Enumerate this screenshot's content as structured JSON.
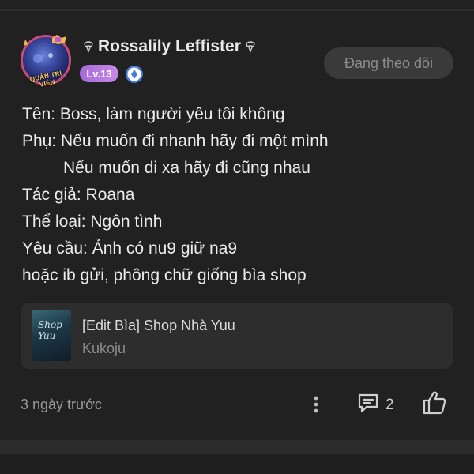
{
  "post": {
    "author": {
      "name": "Rossalily Leffister",
      "level": "Lv.13",
      "role_badge": "QUẢN TRỊ VIÊN"
    },
    "follow_button": "Đang theo dõi",
    "content_lines": [
      "Tên: Boss, làm người yêu tôi không",
      "Phụ: Nếu muốn đi nhanh hãy đi một mình",
      "Nếu muốn di xa hãy đi cũng nhau",
      "Tác giả: Roana",
      "Thể loại: Ngôn tình",
      "Yêu cầu: Ảnh có nu9 giữ na9",
      "hoặc ib gửi, phông chữ giống bìa shop"
    ],
    "link_card": {
      "title": "[Edit Bìa] Shop Nhà Yuu",
      "author": "Kukoju",
      "thumbnail_text": "Shop Yuu"
    },
    "footer": {
      "time": "3 ngày trước",
      "comment_count": "2"
    }
  },
  "icons": {
    "name_decoration": "ghost-bow-icon",
    "verified": "verified-shield-icon",
    "more": "more-vertical-icon",
    "comment": "comment-icon",
    "like": "thumbs-up-icon"
  },
  "colors": {
    "background": "#212121",
    "level_badge": "#b57ae0",
    "verified": "#4a7be0",
    "avatar_ring": "#c84a78",
    "follow_button_bg": "#3a3a3a"
  }
}
